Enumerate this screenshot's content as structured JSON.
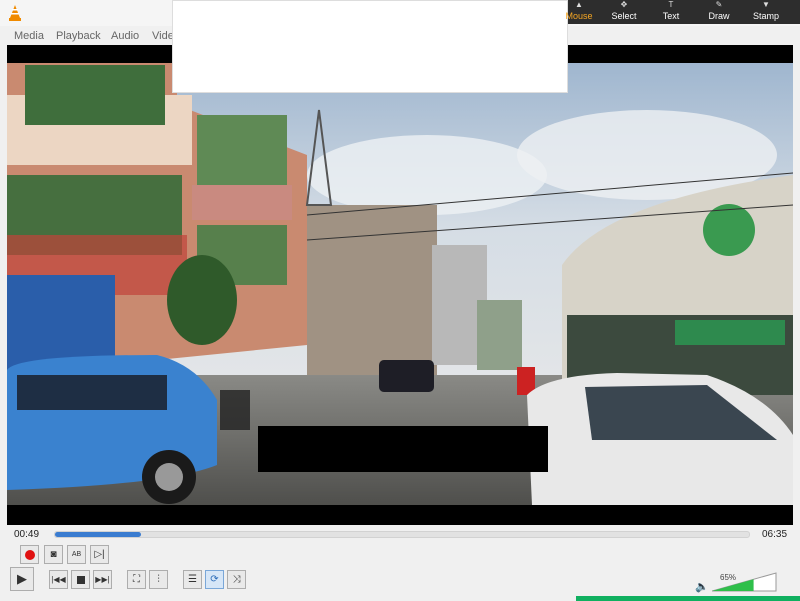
{
  "window": {
    "app_icon": "vlc-cone-icon"
  },
  "menu": {
    "items": [
      "Media",
      "Playback",
      "Audio",
      "Video"
    ]
  },
  "annotation_toolbar": {
    "tools": [
      {
        "label": "Mouse",
        "icon": "cursor-icon",
        "active": true
      },
      {
        "label": "Select",
        "icon": "select-icon"
      },
      {
        "label": "Text",
        "icon": "text-icon"
      },
      {
        "label": "Draw",
        "icon": "pen-icon"
      },
      {
        "label": "Stamp",
        "icon": "stamp-icon"
      }
    ]
  },
  "playback": {
    "elapsed": "00:49",
    "duration": "06:35",
    "progress_fraction": 0.124
  },
  "volume": {
    "percent_label": "65%",
    "level": 0.65
  },
  "colors": {
    "accent": "#3a7cd0",
    "record": "#e01010",
    "volume_fill": "#2fbf4a"
  }
}
